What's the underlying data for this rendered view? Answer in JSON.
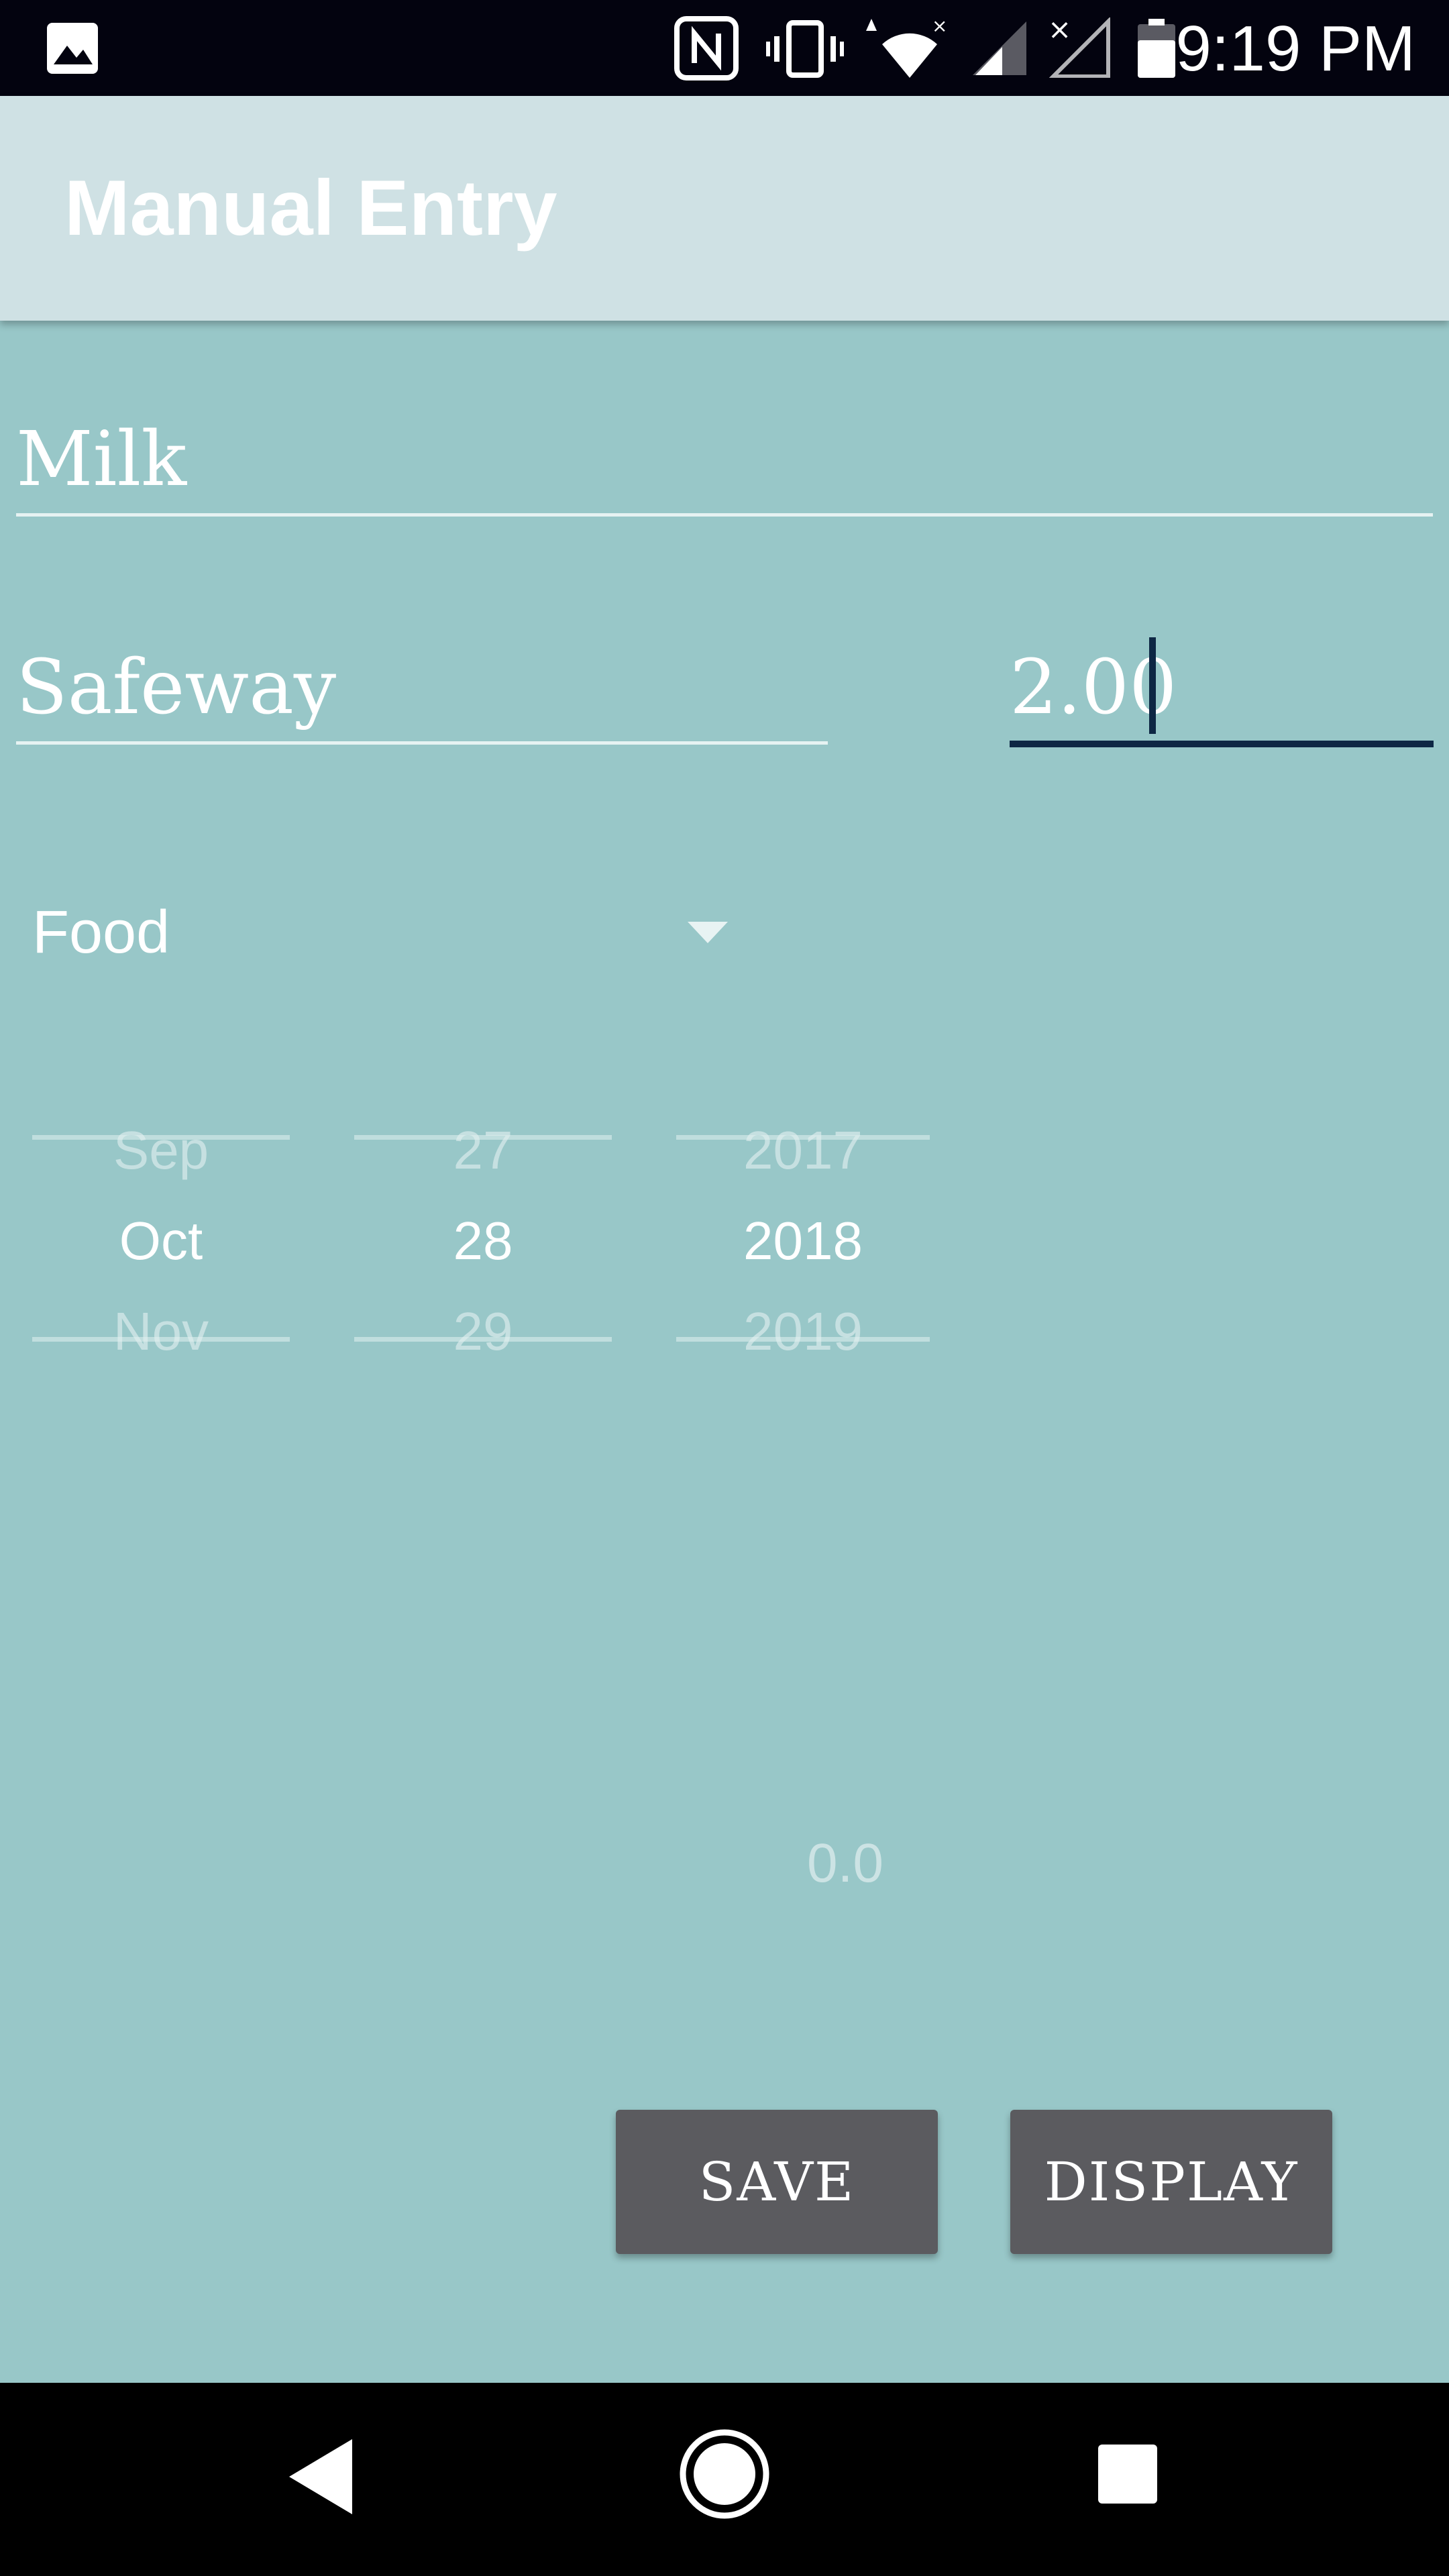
{
  "status_bar": {
    "time": "9:19 PM",
    "icons": [
      "gallery-icon",
      "nfc-icon",
      "vibrate-icon",
      "wifi-icon",
      "signal-icon",
      "no-signal-icon",
      "battery-icon"
    ]
  },
  "toolbar": {
    "title": "Manual Entry"
  },
  "form": {
    "item_name": "Milk",
    "store": "Safeway",
    "price": "2.00",
    "category": "Food"
  },
  "date_picker": {
    "month": {
      "prev": "Sep",
      "selected": "Oct",
      "next": "Nov"
    },
    "day": {
      "prev": "27",
      "selected": "28",
      "next": "29"
    },
    "year": {
      "prev": "2017",
      "selected": "2018",
      "next": "2019"
    }
  },
  "total": "0.0",
  "buttons": {
    "save": "SAVE",
    "display": "DISPLAY"
  },
  "colors": {
    "background": "#98c7c8",
    "toolbar": "#cfe1e4",
    "button": "#5b5b5f",
    "caret": "#0e2744"
  }
}
